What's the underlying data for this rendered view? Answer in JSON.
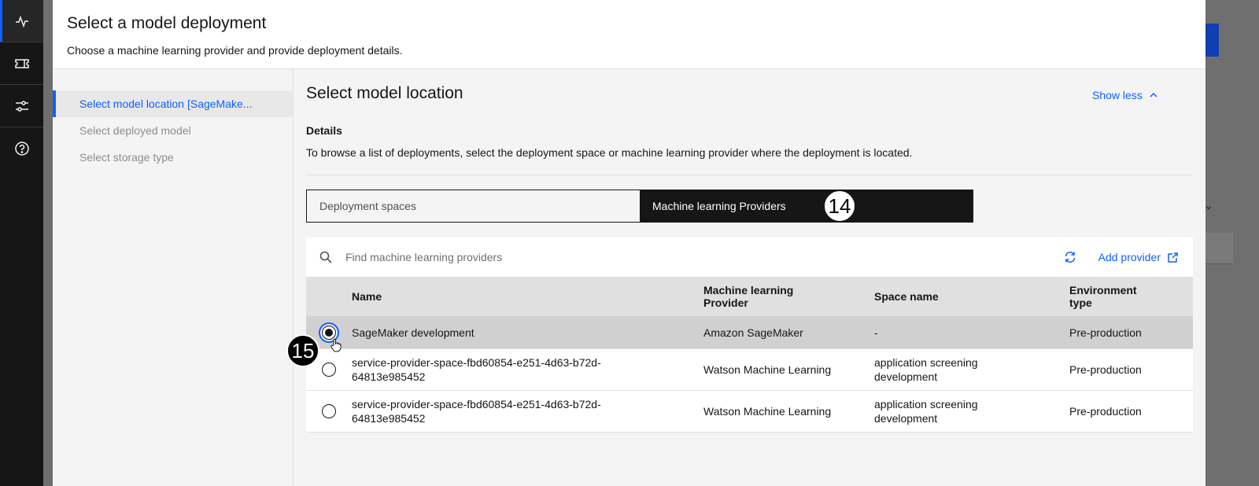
{
  "rail": {
    "items": [
      {
        "icon": "activity-icon",
        "active": true
      },
      {
        "icon": "ticket-icon",
        "active": false
      },
      {
        "icon": "sliders-icon",
        "active": false
      },
      {
        "icon": "help-icon",
        "active": false
      }
    ]
  },
  "modal": {
    "title": "Select a model deployment",
    "subtitle": "Choose a machine learning provider and provide deployment details."
  },
  "steps": [
    {
      "label": "Select model location [SageMake...",
      "active": true
    },
    {
      "label": "Select deployed model",
      "active": false
    },
    {
      "label": "Select storage type",
      "active": false
    }
  ],
  "section": {
    "title": "Select model location",
    "show_less": "Show less",
    "details_heading": "Details",
    "details_text": "To browse a list of deployments, select the deployment space or machine learning provider where the deployment is located."
  },
  "switcher": {
    "option_a": "Deployment spaces",
    "option_b": "Machine learning Providers",
    "selected": "option_b"
  },
  "badges": {
    "step14": "14",
    "step15": "15"
  },
  "toolbar": {
    "search_placeholder": "Find machine learning providers",
    "add_provider": "Add provider"
  },
  "table": {
    "headers": {
      "name": "Name",
      "provider_line1": "Machine learning",
      "provider_line2": "Provider",
      "space": "Space name",
      "env_line1": "Environment",
      "env_line2": "type"
    },
    "rows": [
      {
        "name_1": "SageMaker development",
        "name_2": "",
        "provider": "Amazon SageMaker",
        "space_1": "-",
        "space_2": "",
        "env": "Pre-production",
        "selected": true
      },
      {
        "name_1": "service-provider-space-fbd60854-e251-4d63-b72d-",
        "name_2": "64813e985452",
        "provider": "Watson Machine Learning",
        "space_1": "application screening",
        "space_2": "development",
        "env": "Pre-production",
        "selected": false
      },
      {
        "name_1": "service-provider-space-fbd60854-e251-4d63-b72d-",
        "name_2": "64813e985452",
        "provider": "Watson Machine Learning",
        "space_1": "application screening",
        "space_2": "development",
        "env": "Pre-production",
        "selected": false
      }
    ]
  },
  "colors": {
    "accent": "#0f62fe",
    "rail_bg": "#161616"
  }
}
